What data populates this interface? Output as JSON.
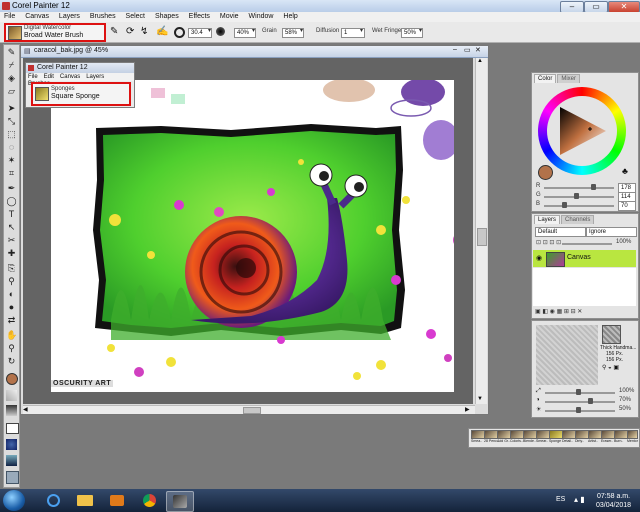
{
  "app": {
    "title": "Corel Painter 12",
    "window_buttons": [
      "–",
      "▭",
      "✕"
    ]
  },
  "menu": [
    "File",
    "Canvas",
    "Layers",
    "Brushes",
    "Select",
    "Shapes",
    "Effects",
    "Movie",
    "Window",
    "Help"
  ],
  "property_bar": {
    "brush_category": "Digital Watercolor",
    "brush_variant": "Broad Water Brush",
    "size_value": "30.4",
    "opacity_value": "40%",
    "grain_label": "Grain",
    "grain_value": "58%",
    "diffusion_label": "Diffusion",
    "diffusion_value": "1",
    "wet_fringe_label": "Wet Fringe:",
    "wet_fringe_value": "50%"
  },
  "document": {
    "title": "caracol_bak.jpg @ 45%",
    "watermark": "OSCURITY ART"
  },
  "mini_window": {
    "title": "Corel Painter 12",
    "menu": [
      "File",
      "Edit",
      "Canvas",
      "Layers",
      "Brushes"
    ],
    "brush_category": "Sponges",
    "brush_variant": "Square Sponge"
  },
  "color_panel": {
    "tabs": [
      "Color",
      "Mixer"
    ],
    "rgb": [
      {
        "label": "R",
        "value": "178"
      },
      {
        "label": "G",
        "value": "114"
      },
      {
        "label": "B",
        "value": "70"
      }
    ],
    "main_color": "#b2724a"
  },
  "layers_panel": {
    "tabs": [
      "Layers",
      "Channels"
    ],
    "composite_method": "Default",
    "preserve": "Ignore",
    "opacity": "100%",
    "layer_name": "Canvas"
  },
  "paper_panel": {
    "paper_name": "Thick Handma...",
    "px1": "156 Px.",
    "px2": "156 Px.",
    "scale": "100%",
    "contrast": "70%",
    "brightness": "50%"
  },
  "brush_strip": [
    "Smea..",
    "28 Penc..",
    "Add Gr..",
    "Coloris..",
    "Blende..",
    "Smear..",
    "Sponge",
    "Detail..",
    "Dirty..",
    "Artist..",
    "Eraser..",
    "Burn..",
    "Mentor.."
  ],
  "taskbar": {
    "language": "ES",
    "time": "07:58 a.m.",
    "date": "03/04/2018"
  }
}
